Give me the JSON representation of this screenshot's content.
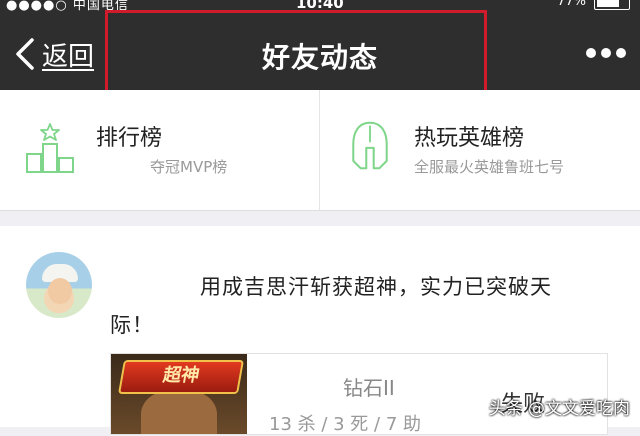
{
  "status_bar": {
    "carrier": "●●●●○ 中国电信",
    "time": "10:40",
    "battery": "77%"
  },
  "nav": {
    "back_label": "返回",
    "title": "好友动态",
    "more_icon": "ellipsis-icon"
  },
  "rank_panel": {
    "left": {
      "title": "排行榜",
      "subtitle": "夺冠MVP榜",
      "icon": "podium-icon"
    },
    "right": {
      "title": "热玩英雄榜",
      "subtitle": "全服最火英雄鲁班七号",
      "icon": "helmet-icon"
    }
  },
  "post": {
    "text": "用成吉思汗斩获超神，实力已突破天际！",
    "card": {
      "badge": "超神",
      "rank": "钻石II",
      "kda": "13 杀 / 3 死 / 7 助",
      "result": "失败"
    }
  },
  "watermark": "头条 @文文爱吃肉",
  "colors": {
    "nav_bg": "#2e2e2e",
    "highlight": "#d01c2a",
    "icon_green": "#7fd68a"
  }
}
